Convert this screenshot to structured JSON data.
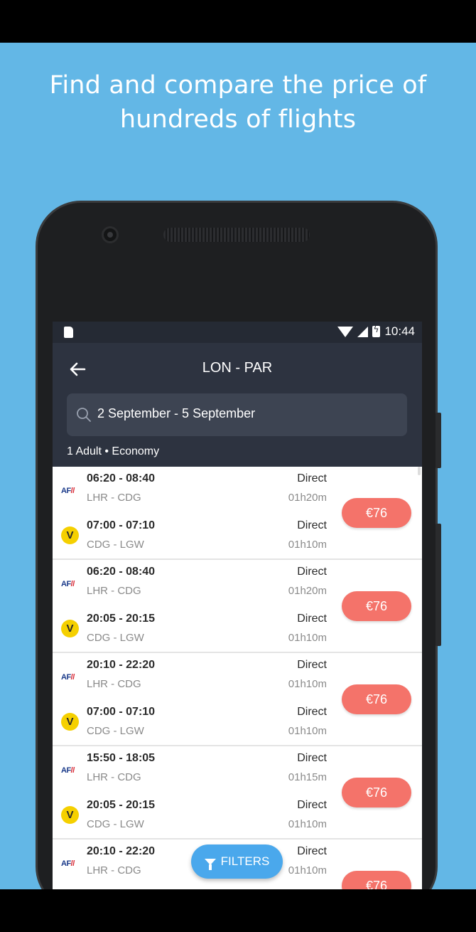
{
  "headline": {
    "line1": "Find and compare the price of",
    "line2": "hundreds of flights"
  },
  "status_bar": {
    "time": "10:44",
    "icons": [
      "sd-card-icon",
      "wifi-icon",
      "signal-icon",
      "battery-charging-icon"
    ]
  },
  "app_bar": {
    "back_icon": "arrow-left-icon",
    "title": "LON - PAR",
    "search_icon": "search-icon",
    "search_value": "2 September - 5 September",
    "passengers": "1 Adult • Economy"
  },
  "results": [
    {
      "outbound": {
        "airline_logo": "AF",
        "times": "06:20 - 08:40",
        "airports": "LHR - CDG",
        "stops": "Direct",
        "duration": "01h20m"
      },
      "return": {
        "airline_logo": "V",
        "times": "07:00 - 07:10",
        "airports": "CDG - LGW",
        "stops": "Direct",
        "duration": "01h10m"
      },
      "price": "€76"
    },
    {
      "outbound": {
        "airline_logo": "AF",
        "times": "06:20 - 08:40",
        "airports": "LHR - CDG",
        "stops": "Direct",
        "duration": "01h20m"
      },
      "return": {
        "airline_logo": "V",
        "times": "20:05 - 20:15",
        "airports": "CDG - LGW",
        "stops": "Direct",
        "duration": "01h10m"
      },
      "price": "€76"
    },
    {
      "outbound": {
        "airline_logo": "AF",
        "times": "20:10 - 22:20",
        "airports": "LHR - CDG",
        "stops": "Direct",
        "duration": "01h10m"
      },
      "return": {
        "airline_logo": "V",
        "times": "07:00 - 07:10",
        "airports": "CDG - LGW",
        "stops": "Direct",
        "duration": "01h10m"
      },
      "price": "€76"
    },
    {
      "outbound": {
        "airline_logo": "AF",
        "times": "15:50 - 18:05",
        "airports": "LHR - CDG",
        "stops": "Direct",
        "duration": "01h15m"
      },
      "return": {
        "airline_logo": "V",
        "times": "20:05 - 20:15",
        "airports": "CDG - LGW",
        "stops": "Direct",
        "duration": "01h10m"
      },
      "price": "€76"
    },
    {
      "outbound": {
        "airline_logo": "AF",
        "times": "20:10 - 22:20",
        "airports": "LHR - CDG",
        "stops": "Direct",
        "duration": "01h10m"
      },
      "return": null,
      "price": "€76"
    }
  ],
  "filters_button": {
    "icon": "funnel-icon",
    "label": "FILTERS"
  },
  "colors": {
    "background": "#63b7e6",
    "app_bar": "#2d3340",
    "price_button": "#f4736a",
    "filters_button": "#4aa8ec"
  }
}
